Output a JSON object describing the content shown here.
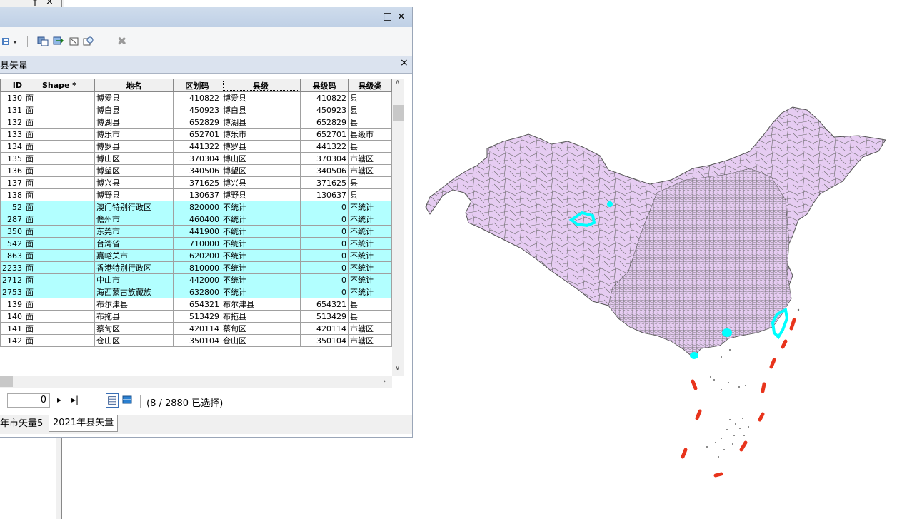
{
  "window": {
    "title_max": "□",
    "title_close": "×",
    "top_pin": "‡",
    "top_close": "×"
  },
  "layer": {
    "name": "县矢量",
    "close": "×"
  },
  "table": {
    "columns": [
      "ID",
      "Shape *",
      "地名",
      "区划码",
      "县级",
      "县级码",
      "县级类"
    ],
    "rows": [
      {
        "id": "130",
        "shape": "面",
        "name": "博爱县",
        "code": "410822",
        "county": "博爱县",
        "ccode": "410822",
        "ctype": "县",
        "selected": false
      },
      {
        "id": "131",
        "shape": "面",
        "name": "博白县",
        "code": "450923",
        "county": "博白县",
        "ccode": "450923",
        "ctype": "县",
        "selected": false
      },
      {
        "id": "132",
        "shape": "面",
        "name": "博湖县",
        "code": "652829",
        "county": "博湖县",
        "ccode": "652829",
        "ctype": "县",
        "selected": false
      },
      {
        "id": "133",
        "shape": "面",
        "name": "博乐市",
        "code": "652701",
        "county": "博乐市",
        "ccode": "652701",
        "ctype": "县级市",
        "selected": false
      },
      {
        "id": "134",
        "shape": "面",
        "name": "博罗县",
        "code": "441322",
        "county": "博罗县",
        "ccode": "441322",
        "ctype": "县",
        "selected": false
      },
      {
        "id": "135",
        "shape": "面",
        "name": "博山区",
        "code": "370304",
        "county": "博山区",
        "ccode": "370304",
        "ctype": "市辖区",
        "selected": false
      },
      {
        "id": "136",
        "shape": "面",
        "name": "博望区",
        "code": "340506",
        "county": "博望区",
        "ccode": "340506",
        "ctype": "市辖区",
        "selected": false
      },
      {
        "id": "137",
        "shape": "面",
        "name": "博兴县",
        "code": "371625",
        "county": "博兴县",
        "ccode": "371625",
        "ctype": "县",
        "selected": false
      },
      {
        "id": "138",
        "shape": "面",
        "name": "博野县",
        "code": "130637",
        "county": "博野县",
        "ccode": "130637",
        "ctype": "县",
        "selected": false
      },
      {
        "id": "52",
        "shape": "面",
        "name": "澳门特别行政区",
        "code": "820000",
        "county": "不统计",
        "ccode": "0",
        "ctype": "不统计",
        "selected": true
      },
      {
        "id": "287",
        "shape": "面",
        "name": "儋州市",
        "code": "460400",
        "county": "不统计",
        "ccode": "0",
        "ctype": "不统计",
        "selected": true
      },
      {
        "id": "350",
        "shape": "面",
        "name": "东莞市",
        "code": "441900",
        "county": "不统计",
        "ccode": "0",
        "ctype": "不统计",
        "selected": true
      },
      {
        "id": "542",
        "shape": "面",
        "name": "台湾省",
        "code": "710000",
        "county": "不统计",
        "ccode": "0",
        "ctype": "不统计",
        "selected": true
      },
      {
        "id": "863",
        "shape": "面",
        "name": "嘉峪关市",
        "code": "620200",
        "county": "不统计",
        "ccode": "0",
        "ctype": "不统计",
        "selected": true
      },
      {
        "id": "2233",
        "shape": "面",
        "name": "香港特别行政区",
        "code": "810000",
        "county": "不统计",
        "ccode": "0",
        "ctype": "不统计",
        "selected": true
      },
      {
        "id": "2712",
        "shape": "面",
        "name": "中山市",
        "code": "442000",
        "county": "不统计",
        "ccode": "0",
        "ctype": "不统计",
        "selected": true
      },
      {
        "id": "2753",
        "shape": "面",
        "name": "海西蒙古族藏族",
        "code": "632800",
        "county": "不统计",
        "ccode": "0",
        "ctype": "不统计",
        "selected": true
      },
      {
        "id": "139",
        "shape": "面",
        "name": "布尔津县",
        "code": "654321",
        "county": "布尔津县",
        "ccode": "654321",
        "ctype": "县",
        "selected": false
      },
      {
        "id": "140",
        "shape": "面",
        "name": "布拖县",
        "code": "513429",
        "county": "布拖县",
        "ccode": "513429",
        "ctype": "县",
        "selected": false
      },
      {
        "id": "141",
        "shape": "面",
        "name": "蔡甸区",
        "code": "420114",
        "county": "蔡甸区",
        "ccode": "420114",
        "ctype": "市辖区",
        "selected": false
      },
      {
        "id": "142",
        "shape": "面",
        "name": "仓山区",
        "code": "350104",
        "county": "仓山区",
        "ccode": "350104",
        "ctype": "市辖区",
        "selected": false
      }
    ]
  },
  "navigation": {
    "record": "0",
    "next": "▸",
    "last": "▸|",
    "status": "(8 / 2880 已选择)"
  },
  "tabs": [
    "年市矢量5",
    "2021年县矢量"
  ],
  "colors": {
    "map_fill": "#e6ccf2",
    "map_border": "#666666",
    "selected_fill": "#00ffff",
    "dash_line": "#e8341c",
    "selected_row": "#b2ffff"
  }
}
